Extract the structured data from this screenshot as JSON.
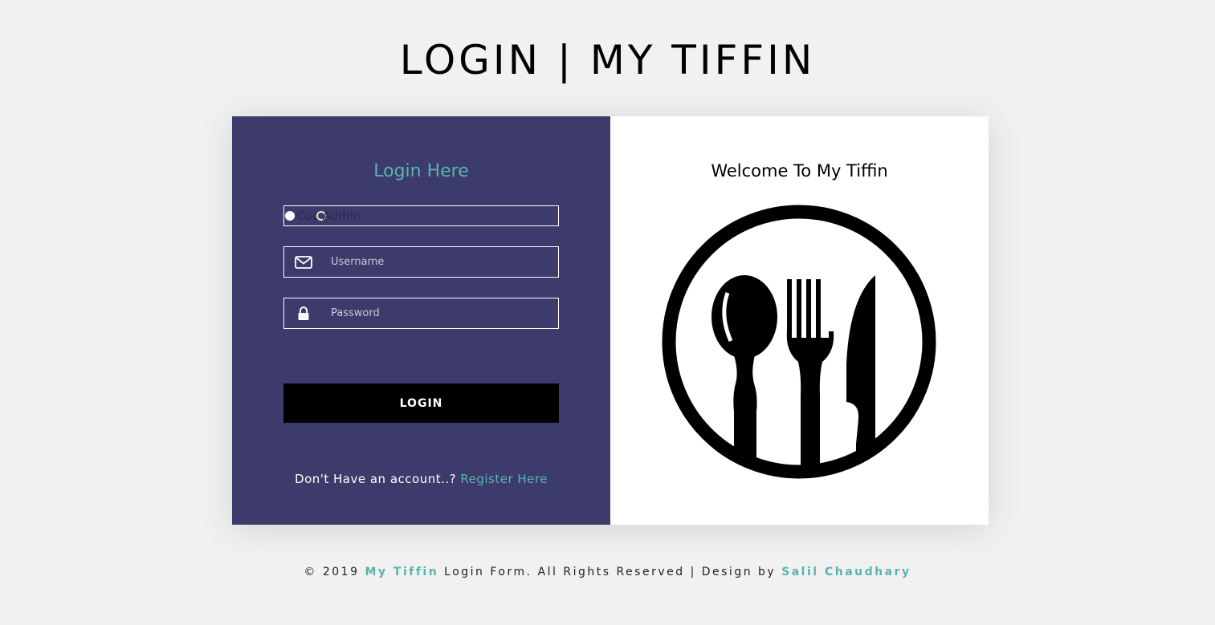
{
  "header": {
    "title": "LOGIN | MY TIFFIN"
  },
  "login_panel": {
    "heading": "Login Here",
    "roles": [
      {
        "label": "Cook",
        "selected": true
      },
      {
        "label": "Admin",
        "selected": false
      }
    ],
    "username": {
      "placeholder": "Username",
      "value": "",
      "icon": "envelope-icon"
    },
    "password": {
      "placeholder": "Password",
      "value": "",
      "icon": "lock-icon"
    },
    "login_button": "LOGIN",
    "register_prompt": "Don't Have an account..?",
    "register_link": "Register Here"
  },
  "welcome_panel": {
    "heading": "Welcome To My Tiffin",
    "logo": "plate-cutlery-icon"
  },
  "footer": {
    "copyright": "© 2019",
    "brand": "My Tiffin",
    "middle": "Login Form. All Rights Reserved | Design by",
    "designer": "Salil Chaudhary"
  },
  "colors": {
    "background": "#f1f1f1",
    "panel": "#3c3b6c",
    "accent": "#58b4ae",
    "button": "#000000"
  }
}
